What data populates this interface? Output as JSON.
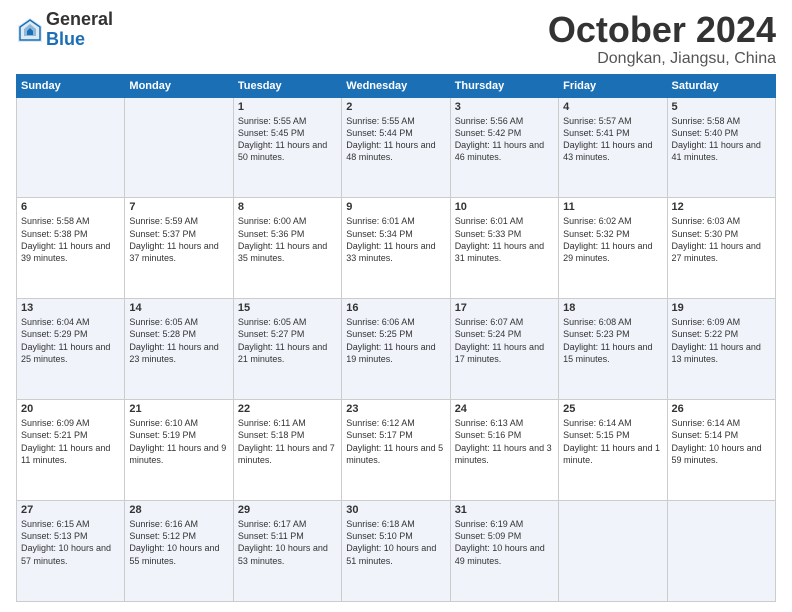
{
  "header": {
    "logo_general": "General",
    "logo_blue": "Blue",
    "month_title": "October 2024",
    "location": "Dongkan, Jiangsu, China"
  },
  "days_of_week": [
    "Sunday",
    "Monday",
    "Tuesday",
    "Wednesday",
    "Thursday",
    "Friday",
    "Saturday"
  ],
  "weeks": [
    [
      {
        "day": "",
        "text": ""
      },
      {
        "day": "",
        "text": ""
      },
      {
        "day": "1",
        "text": "Sunrise: 5:55 AM\nSunset: 5:45 PM\nDaylight: 11 hours and 50 minutes."
      },
      {
        "day": "2",
        "text": "Sunrise: 5:55 AM\nSunset: 5:44 PM\nDaylight: 11 hours and 48 minutes."
      },
      {
        "day": "3",
        "text": "Sunrise: 5:56 AM\nSunset: 5:42 PM\nDaylight: 11 hours and 46 minutes."
      },
      {
        "day": "4",
        "text": "Sunrise: 5:57 AM\nSunset: 5:41 PM\nDaylight: 11 hours and 43 minutes."
      },
      {
        "day": "5",
        "text": "Sunrise: 5:58 AM\nSunset: 5:40 PM\nDaylight: 11 hours and 41 minutes."
      }
    ],
    [
      {
        "day": "6",
        "text": "Sunrise: 5:58 AM\nSunset: 5:38 PM\nDaylight: 11 hours and 39 minutes."
      },
      {
        "day": "7",
        "text": "Sunrise: 5:59 AM\nSunset: 5:37 PM\nDaylight: 11 hours and 37 minutes."
      },
      {
        "day": "8",
        "text": "Sunrise: 6:00 AM\nSunset: 5:36 PM\nDaylight: 11 hours and 35 minutes."
      },
      {
        "day": "9",
        "text": "Sunrise: 6:01 AM\nSunset: 5:34 PM\nDaylight: 11 hours and 33 minutes."
      },
      {
        "day": "10",
        "text": "Sunrise: 6:01 AM\nSunset: 5:33 PM\nDaylight: 11 hours and 31 minutes."
      },
      {
        "day": "11",
        "text": "Sunrise: 6:02 AM\nSunset: 5:32 PM\nDaylight: 11 hours and 29 minutes."
      },
      {
        "day": "12",
        "text": "Sunrise: 6:03 AM\nSunset: 5:30 PM\nDaylight: 11 hours and 27 minutes."
      }
    ],
    [
      {
        "day": "13",
        "text": "Sunrise: 6:04 AM\nSunset: 5:29 PM\nDaylight: 11 hours and 25 minutes."
      },
      {
        "day": "14",
        "text": "Sunrise: 6:05 AM\nSunset: 5:28 PM\nDaylight: 11 hours and 23 minutes."
      },
      {
        "day": "15",
        "text": "Sunrise: 6:05 AM\nSunset: 5:27 PM\nDaylight: 11 hours and 21 minutes."
      },
      {
        "day": "16",
        "text": "Sunrise: 6:06 AM\nSunset: 5:25 PM\nDaylight: 11 hours and 19 minutes."
      },
      {
        "day": "17",
        "text": "Sunrise: 6:07 AM\nSunset: 5:24 PM\nDaylight: 11 hours and 17 minutes."
      },
      {
        "day": "18",
        "text": "Sunrise: 6:08 AM\nSunset: 5:23 PM\nDaylight: 11 hours and 15 minutes."
      },
      {
        "day": "19",
        "text": "Sunrise: 6:09 AM\nSunset: 5:22 PM\nDaylight: 11 hours and 13 minutes."
      }
    ],
    [
      {
        "day": "20",
        "text": "Sunrise: 6:09 AM\nSunset: 5:21 PM\nDaylight: 11 hours and 11 minutes."
      },
      {
        "day": "21",
        "text": "Sunrise: 6:10 AM\nSunset: 5:19 PM\nDaylight: 11 hours and 9 minutes."
      },
      {
        "day": "22",
        "text": "Sunrise: 6:11 AM\nSunset: 5:18 PM\nDaylight: 11 hours and 7 minutes."
      },
      {
        "day": "23",
        "text": "Sunrise: 6:12 AM\nSunset: 5:17 PM\nDaylight: 11 hours and 5 minutes."
      },
      {
        "day": "24",
        "text": "Sunrise: 6:13 AM\nSunset: 5:16 PM\nDaylight: 11 hours and 3 minutes."
      },
      {
        "day": "25",
        "text": "Sunrise: 6:14 AM\nSunset: 5:15 PM\nDaylight: 11 hours and 1 minute."
      },
      {
        "day": "26",
        "text": "Sunrise: 6:14 AM\nSunset: 5:14 PM\nDaylight: 10 hours and 59 minutes."
      }
    ],
    [
      {
        "day": "27",
        "text": "Sunrise: 6:15 AM\nSunset: 5:13 PM\nDaylight: 10 hours and 57 minutes."
      },
      {
        "day": "28",
        "text": "Sunrise: 6:16 AM\nSunset: 5:12 PM\nDaylight: 10 hours and 55 minutes."
      },
      {
        "day": "29",
        "text": "Sunrise: 6:17 AM\nSunset: 5:11 PM\nDaylight: 10 hours and 53 minutes."
      },
      {
        "day": "30",
        "text": "Sunrise: 6:18 AM\nSunset: 5:10 PM\nDaylight: 10 hours and 51 minutes."
      },
      {
        "day": "31",
        "text": "Sunrise: 6:19 AM\nSunset: 5:09 PM\nDaylight: 10 hours and 49 minutes."
      },
      {
        "day": "",
        "text": ""
      },
      {
        "day": "",
        "text": ""
      }
    ]
  ]
}
